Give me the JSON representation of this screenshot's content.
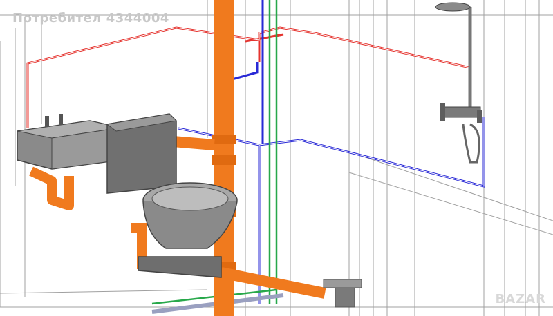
{
  "watermark": {
    "text": "Потребител 4344004"
  },
  "brand": {
    "text": "BAZAR"
  },
  "colors": {
    "hot_pipe": "#e5342f",
    "cold_pipe": "#2a2ad6",
    "drain_pipe": "#f07a1e",
    "green_pipe": "#27a84a",
    "fixture": "#8a8a8a",
    "fixture_dark": "#5e5e5e",
    "wall_line": "#9a9a9a"
  },
  "icons": [
    "wash-basin",
    "toilet",
    "shower-mixer",
    "shower-head",
    "floor-drain"
  ]
}
